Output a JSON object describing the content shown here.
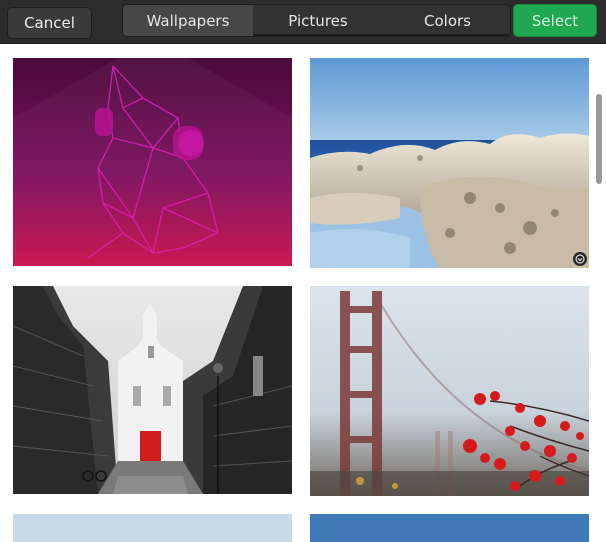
{
  "header": {
    "cancel_label": "Cancel",
    "select_label": "Select",
    "tabs": [
      {
        "label": "Wallpapers",
        "active": true
      },
      {
        "label": "Pictures",
        "active": false
      },
      {
        "label": "Colors",
        "active": false
      }
    ]
  },
  "colors": {
    "accent_green": "#1fa84f",
    "header_bg": "#2c2c2c"
  },
  "wallpapers": [
    {
      "name": "purple-origami-dog",
      "selected": false
    },
    {
      "name": "rocky-coast",
      "selected": true
    },
    {
      "name": "church-alley",
      "selected": false
    },
    {
      "name": "golden-gate-flowers",
      "selected": false
    },
    {
      "name": "pale-sky",
      "selected": false
    },
    {
      "name": "blue-sky",
      "selected": false
    }
  ]
}
